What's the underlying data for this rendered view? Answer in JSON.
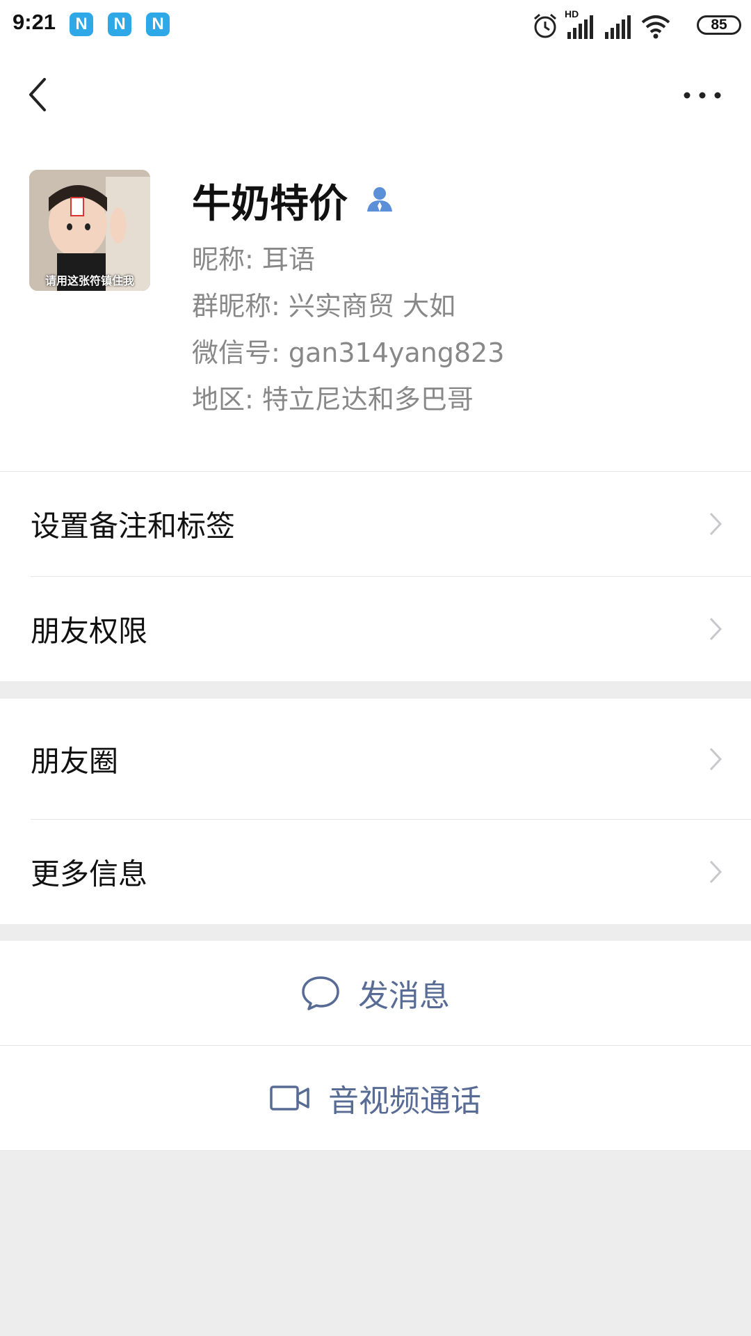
{
  "status_bar": {
    "time": "9:21",
    "notification_badge": "N",
    "battery": "85",
    "network_label": "HD"
  },
  "nav": {
    "back_icon": "chevron-left-icon",
    "more_icon": "more-dots-icon"
  },
  "profile": {
    "name": "牛奶特价",
    "avatar_caption": "请用这张符镇住我",
    "nickname": "昵称: 耳语",
    "group_nickname": "群昵称: 兴实商贸  大如",
    "wechat_id": "微信号: gan314yang823",
    "region": "地区: 特立尼达和多巴哥"
  },
  "menu_group_1": [
    {
      "label": "设置备注和标签"
    },
    {
      "label": "朋友权限"
    }
  ],
  "menu_group_2": [
    {
      "label": "朋友圈"
    },
    {
      "label": "更多信息"
    }
  ],
  "actions": {
    "send_message": "发消息",
    "av_call": "音视频通话"
  },
  "colors": {
    "link_blue": "#576b95",
    "background_gray": "#ededed",
    "badge_blue": "#2fa8e8",
    "contact_icon_blue": "#5b8fd8"
  }
}
